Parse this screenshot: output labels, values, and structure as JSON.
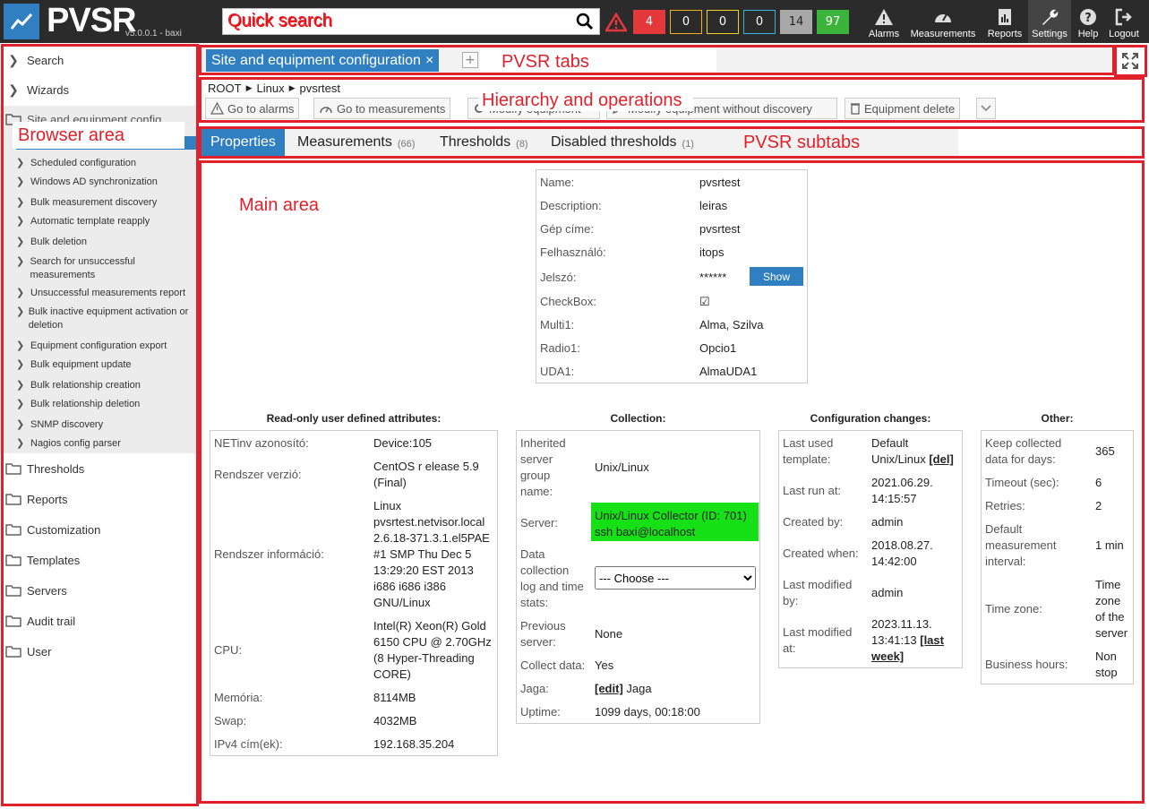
{
  "app": {
    "brand": "PVSR",
    "version": "v5.0.0.1 - baxi"
  },
  "search": {
    "placeholder": "Quick search"
  },
  "badges": [
    {
      "value": "4",
      "bg": "#e5383b",
      "fg": "#ffffff",
      "border": "#e5383b"
    },
    {
      "value": "0",
      "bg": "#2b2b2b",
      "fg": "#ffffff",
      "border": "#f0b020"
    },
    {
      "value": "0",
      "bg": "#2b2b2b",
      "fg": "#ffffff",
      "border": "#f0d020"
    },
    {
      "value": "0",
      "bg": "#2b2b2b",
      "fg": "#ffffff",
      "border": "#3ab0e0"
    },
    {
      "value": "14",
      "bg": "#a8a8a8",
      "fg": "#222222",
      "border": "#a8a8a8"
    },
    {
      "value": "97",
      "bg": "#3cb43c",
      "fg": "#ffffff",
      "border": "#3cb43c"
    }
  ],
  "nav": {
    "alarms": "Alarms",
    "measurements": "Measurements",
    "reports": "Reports",
    "settings": "Settings",
    "help": "Help",
    "logout": "Logout"
  },
  "sidebar": {
    "search": "Search",
    "wizards": "Wizards",
    "site_config": "Site and equipment config",
    "subitems": [
      "Site and equipment configuration",
      "Scheduled configuration",
      "Windows AD synchronization",
      "Bulk measurement discovery",
      "Automatic template reapply",
      "Bulk deletion",
      "Search for unsuccessful measurements",
      "Unsuccessful measurements report",
      "Bulk inactive equipment activation or deletion",
      "Equipment configuration export",
      "Bulk equipment update",
      "Bulk relationship creation",
      "Bulk relationship deletion",
      "SNMP discovery",
      "Nagios config parser"
    ],
    "folders": [
      "Thresholds",
      "Reports",
      "Customization",
      "Templates",
      "Servers",
      "Audit trail",
      "User"
    ]
  },
  "annotations": {
    "quick_search": "Quick search",
    "tabs": "PVSR tabs",
    "hierarchy": "Hierarchy and operations",
    "browser": "Browser area",
    "subtabs": "PVSR subtabs",
    "main": "Main area",
    "color": "#e0202a"
  },
  "tabs": {
    "main": "Site and equipment configuration",
    "close": "×",
    "add": "+"
  },
  "breadcrumb": [
    "ROOT",
    "Linux",
    "pvsrtest"
  ],
  "operations": {
    "go_alarms": "Go to alarms",
    "go_measurements": "Go to measurements",
    "modify": "Modify equipment",
    "modify_nodisc": "Modify equipment without discovery",
    "delete": "Equipment delete"
  },
  "subtabs": [
    {
      "label": "Properties",
      "count": ""
    },
    {
      "label": "Measurements",
      "count": "(66)"
    },
    {
      "label": "Thresholds",
      "count": "(8)"
    },
    {
      "label": "Disabled thresholds",
      "count": "(1)"
    }
  ],
  "properties": {
    "labels": [
      "Name:",
      "Description:",
      "Gép címe:",
      "Felhasználó:",
      "Jelszó:",
      "CheckBox:",
      "Multi1:",
      "Radio1:",
      "UDA1:"
    ],
    "values": [
      "pvsrtest",
      "leiras",
      "pvsrtest",
      "itops",
      "******",
      "☑",
      "Alma, Szilva",
      "Opcio1",
      "AlmaUDA1"
    ],
    "show_btn": "Show"
  },
  "readonly": {
    "title": "Read-only user defined attributes:",
    "rows": [
      {
        "label": "NETinv azonosító:",
        "value": "Device:105"
      },
      {
        "label": "Rendszer verzió:",
        "value": "CentOS r elease 5.9 (Final)"
      },
      {
        "label": "Rendszer információ:",
        "value": "Linux pvsrtest.netvisor.local 2.6.18-371.3.1.el5PAE #1 SMP Thu Dec 5 13:29:20 EST 2013 i686 i686 i386 GNU/Linux"
      },
      {
        "label": "CPU:",
        "value": "Intel(R) Xeon(R) Gold 6150 CPU @ 2.70GHz (8 Hyper-Threading CORE)"
      },
      {
        "label": "Memória:",
        "value": "8114MB"
      },
      {
        "label": "Swap:",
        "value": "4032MB"
      },
      {
        "label": "IPv4 cím(ek):",
        "value": "192.168.35.204"
      }
    ]
  },
  "collection": {
    "title": "Collection:",
    "inherited_label": "Inherited server group name:",
    "inherited_value": "Unix/Linux",
    "server_label": "Server:",
    "server_value": "Unix/Linux Collector (ID: 701) ssh baxi@localhost",
    "log_label": "Data collection log and time stats:",
    "choose": "--- Choose ---",
    "prev_label": "Previous server:",
    "prev_value": "None",
    "collect_label": "Collect data:",
    "collect_value": "Yes",
    "jaga_label": "Jaga:",
    "jaga_edit": "[edit]",
    "jaga_value": "Jaga",
    "uptime_label": "Uptime:",
    "uptime_value": "1099 days, 00:18:00",
    "server_color": "#16e016"
  },
  "config_changes": {
    "title": "Configuration changes:",
    "template_label": "Last used template:",
    "template_value": "Default Unix/Linux",
    "template_del": "[del]",
    "lastrun_label": "Last run at:",
    "lastrun_value": "2021.06.29. 14:15:57",
    "createdby_label": "Created by:",
    "createdby_value": "admin",
    "createdwhen_label": "Created when:",
    "createdwhen_value": "2018.08.27. 14:42:00",
    "modby_label": "Last modified by:",
    "modby_value": "admin",
    "modat_label": "Last modified at:",
    "modat_value": "2023.11.13. 13:41:13",
    "modat_link": "[last week]"
  },
  "other": {
    "title": "Other:",
    "rows": [
      {
        "label": "Keep collected data for days:",
        "value": "365"
      },
      {
        "label": "Timeout (sec):",
        "value": "6"
      },
      {
        "label": "Retries:",
        "value": "2"
      },
      {
        "label": "Default measurement interval:",
        "value": "1 min"
      },
      {
        "label": "Time zone:",
        "value": "Time zone of the server"
      },
      {
        "label": "Business hours:",
        "value": "Non stop"
      }
    ]
  }
}
